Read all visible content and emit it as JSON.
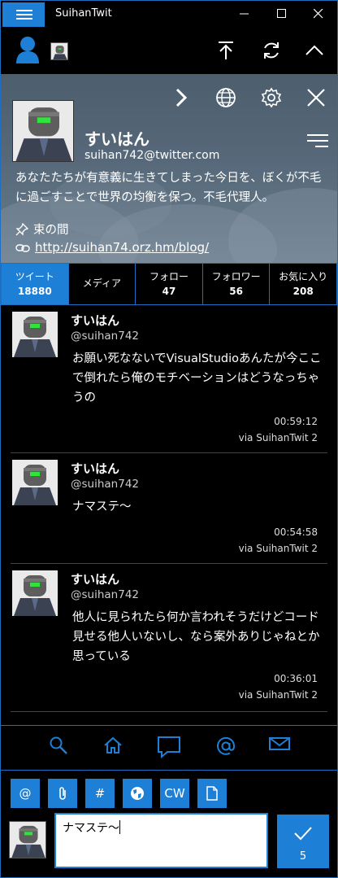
{
  "app": {
    "title": "SuihanTwit"
  },
  "profile": {
    "name": "すいはん",
    "screen_name": "suihan742@twitter.com",
    "bio": "あなたたちが有意義に生きてしまった今日を、ぼくが不毛に過ごすことで世界の均衡を保つ。不毛代理人。",
    "location": "束の間",
    "url": "http://suihan74.orz.hm/blog/"
  },
  "tabs": [
    {
      "label": "ツイート",
      "count": "18880"
    },
    {
      "label": "メディア",
      "count": ""
    },
    {
      "label": "フォロー",
      "count": "47"
    },
    {
      "label": "フォロワー",
      "count": "56"
    },
    {
      "label": "お気に入り",
      "count": "208"
    }
  ],
  "tweets": [
    {
      "name": "すいはん",
      "screen_name": "@suihan742",
      "text": "お願い死なないでVisualStudioあんたが今ここで倒れたら俺のモチベーションはどうなっちゃうの",
      "time": "00:59:12",
      "via": "via SuihanTwit 2"
    },
    {
      "name": "すいはん",
      "screen_name": "@suihan742",
      "text": "ナマステ〜",
      "time": "00:54:58",
      "via": "via SuihanTwit 2"
    },
    {
      "name": "すいはん",
      "screen_name": "@suihan742",
      "text": "他人に見られたら何か言われそうだけどコード見せる他人いないし、なら案外ありじゃねとか思っている",
      "time": "00:36:01",
      "via": "via SuihanTwit 2"
    }
  ],
  "compose": {
    "buttons": {
      "mention": "@",
      "hashtag": "#",
      "cw": "CW"
    },
    "text": "ナマステ〜",
    "remaining": "5"
  },
  "colors": {
    "accent": "#1e7fd6",
    "border": "#1e6fc0",
    "background": "#000000"
  },
  "icons": {
    "titlebar": [
      "hamburger-icon",
      "minimize-icon",
      "maximize-icon",
      "close-icon"
    ],
    "account": [
      "person-icon",
      "scroll-top-icon",
      "refresh-icon",
      "collapse-icon"
    ],
    "profile": [
      "chevron-right-icon",
      "globe-icon",
      "gear-icon",
      "close-icon",
      "menu-icon",
      "pin-icon",
      "link-icon"
    ],
    "nav": [
      "search-icon",
      "home-icon",
      "reply-icon",
      "mention-icon",
      "mail-icon"
    ],
    "compose": [
      "attach-icon",
      "globe-icon",
      "document-icon",
      "check-icon"
    ]
  }
}
